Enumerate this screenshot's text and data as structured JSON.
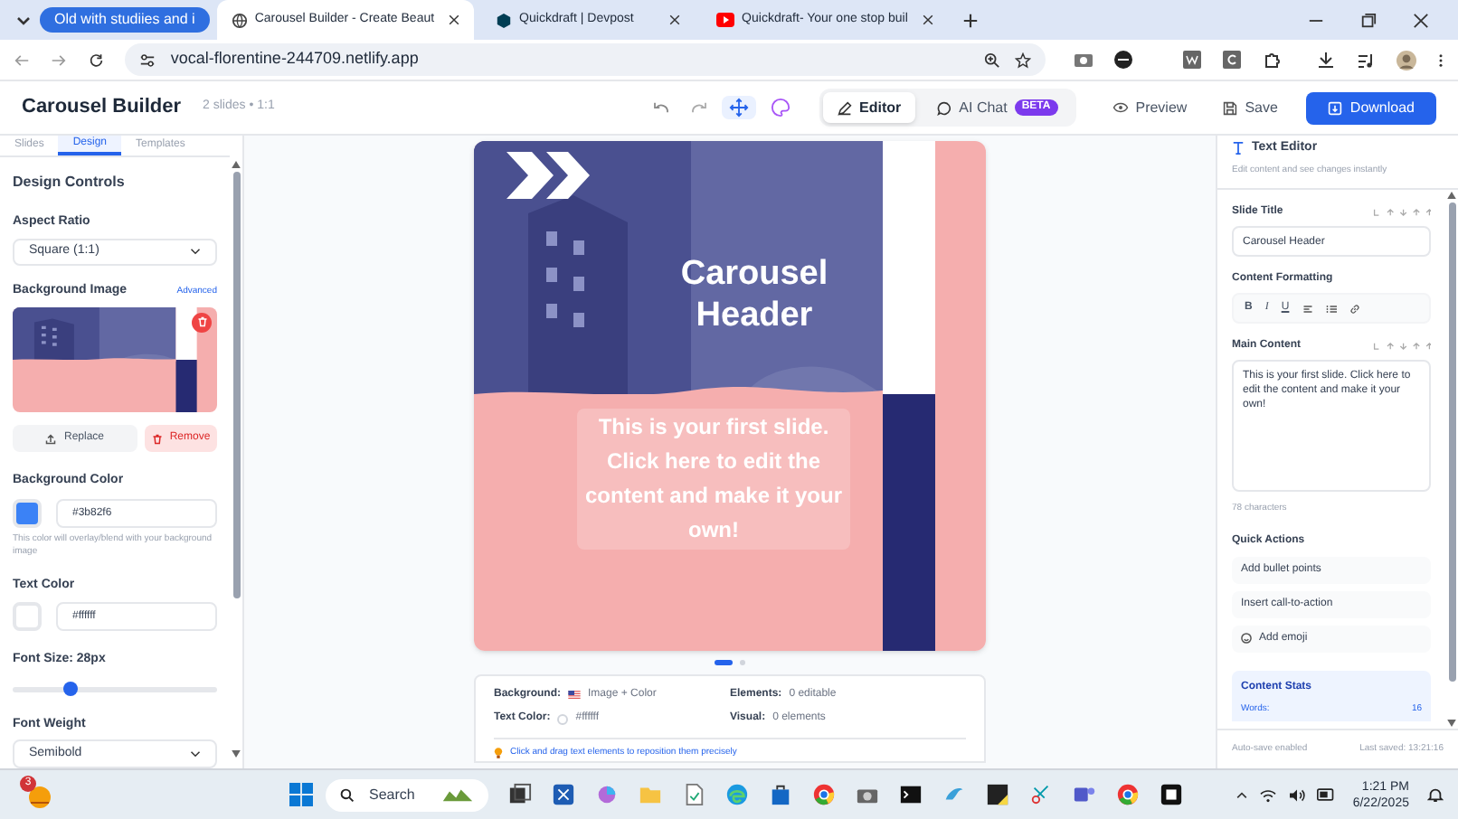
{
  "browser": {
    "tab_group": "Old with studiies and i",
    "tabs": [
      {
        "title": "Carousel Builder - Create Beaut",
        "selected": true,
        "kind": "globe"
      },
      {
        "title": "Quickdraft | Devpost",
        "selected": false,
        "kind": "devpost"
      },
      {
        "title": "Quickdraft- Your one stop buil",
        "selected": false,
        "kind": "video"
      }
    ],
    "url": "vocal-florentine-244709.netlify.app"
  },
  "header": {
    "title": "Carousel Builder",
    "subtitle": "2 slides • 1:1",
    "modes": [
      {
        "label": "Editor",
        "selected": true,
        "kind": "pen"
      },
      {
        "label": "AI Chat",
        "badge": "BETA",
        "selected": false,
        "kind": "chat"
      }
    ],
    "preview": "Preview",
    "save": "Save",
    "download": "Download"
  },
  "left_panel": {
    "tabs": [
      {
        "label": "Slides",
        "selected": false
      },
      {
        "label": "Design",
        "selected": true
      },
      {
        "label": "Templates",
        "selected": false
      }
    ],
    "section_title": "Design Controls",
    "aspect_ratio": {
      "label": "Aspect Ratio",
      "value": "Square (1:1)"
    },
    "background_image": {
      "label": "Background Image",
      "advanced": "Advanced",
      "replace": "Replace",
      "remove": "Remove"
    },
    "background_color": {
      "label": "Background Color",
      "value": "#3b82f6",
      "hint": "This color will overlay/blend with your background image"
    },
    "text_color": {
      "label": "Text Color",
      "value": "#ffffff"
    },
    "font_size": {
      "label": "Font Size: 28px",
      "level": 0.28
    },
    "font_weight": {
      "label": "Font Weight",
      "value": "Semibold"
    }
  },
  "slide": {
    "title": "Carousel Header",
    "body": "This is your first slide. Click here to edit the content and make it your own!"
  },
  "pager": [
    {
      "selected": true
    },
    {
      "selected": false
    }
  ],
  "info": {
    "rows": [
      {
        "label": "Background:",
        "value": "Image + Color",
        "kind": "flag"
      },
      {
        "label": "Elements:",
        "value": "0 editable",
        "kind": "plain"
      },
      {
        "label": "Text Color:",
        "value": "#ffffff",
        "kind": "swatch"
      },
      {
        "label": "Visual:",
        "value": "0 elements",
        "kind": "plain"
      }
    ],
    "tip": "Click and drag text elements to reposition them precisely"
  },
  "right_panel": {
    "title": "Text Editor",
    "subtitle": "Edit content and see changes instantly",
    "slide_title": {
      "label": "Slide Title",
      "value": "Carousel Header"
    },
    "formatting_label": "Content Formatting",
    "formatting": [
      "B",
      "I",
      "U"
    ],
    "main_content": {
      "label": "Main Content",
      "value": "This is your first slide. Click here to edit the content and make it your own!",
      "count": "78 characters"
    },
    "quick_actions": {
      "label": "Quick Actions",
      "items": [
        {
          "label": "Add bullet points",
          "kind": "plain"
        },
        {
          "label": "Insert call-to-action",
          "kind": "plain"
        },
        {
          "label": "Add emoji",
          "kind": "emoji"
        }
      ]
    },
    "stats": {
      "title": "Content Stats",
      "rows": [
        {
          "label": "Words:",
          "value": "16"
        }
      ]
    },
    "autosave": "Auto-save enabled",
    "last_saved": "Last saved: 13:21:16"
  },
  "taskbar": {
    "weather_badge": "3",
    "search": "Search",
    "time": "1:21 PM",
    "date": "6/22/2025"
  }
}
